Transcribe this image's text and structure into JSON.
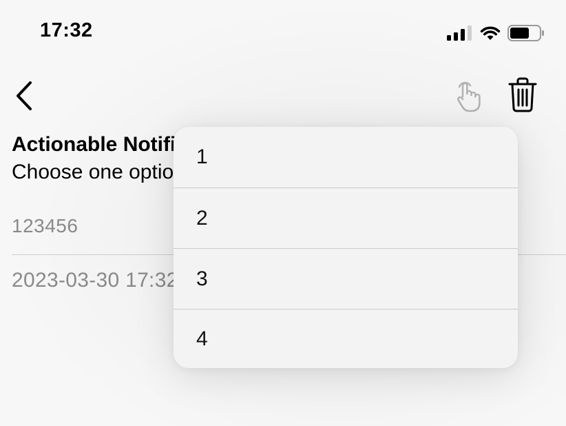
{
  "status_bar": {
    "time": "17:32",
    "icons": [
      "signal-icon",
      "wifi-icon",
      "battery-icon"
    ]
  },
  "nav_bar": {
    "icons": [
      "chevron-left-icon",
      "tap-gesture-icon",
      "trash-icon"
    ]
  },
  "note": {
    "title": "Actionable Notification",
    "subtitle": "Choose one option",
    "id": "123456",
    "date": "2023-03-30 17:32"
  },
  "menu": {
    "options": [
      "1",
      "2",
      "3",
      "4"
    ]
  },
  "colors": {
    "background": "#f7f7f7",
    "secondary_text": "#8a8a8a",
    "disabled_icon": "#b5b5b5",
    "menu_background": "#f3f3f3"
  }
}
